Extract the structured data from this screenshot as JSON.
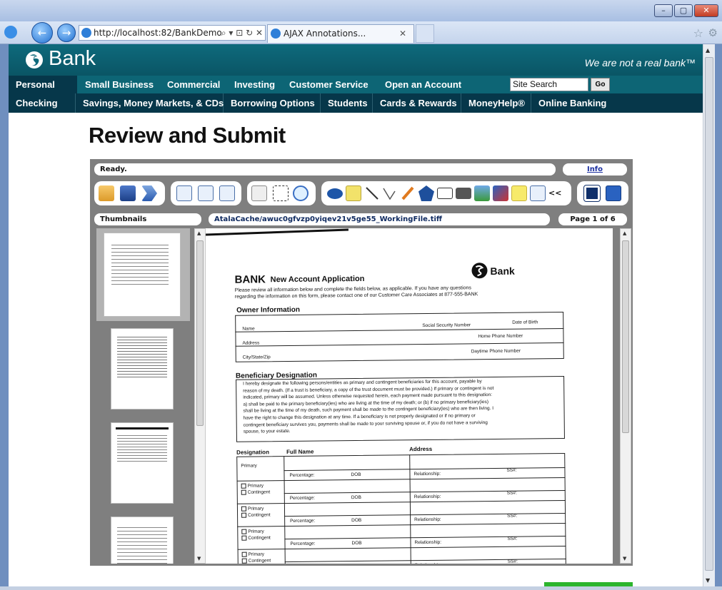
{
  "browser": {
    "window_controls": {
      "minimize": "–",
      "maximize": "▢",
      "close": "✕"
    },
    "address_url": "http://localhost:82/BankDemo",
    "address_tools": "⌕ ▾ ⊡ ↻ ✕",
    "tab_title": "AJAX Annotations...",
    "tab_close": "✕",
    "back_glyph": "←",
    "forward_glyph": "→",
    "favorites_glyph": "☆",
    "tools_glyph": "⚙"
  },
  "site": {
    "brand": "Bank",
    "tagline": "We are not a real bank™",
    "top_nav": [
      "Personal",
      "Small Business",
      "Commercial",
      "Investing",
      "Customer Service",
      "Open an Account"
    ],
    "search_value": "Site Search",
    "go_label": "Go",
    "sub_nav": [
      "Checking",
      "Savings, Money Markets, & CDs",
      "Borrowing Options",
      "Students",
      "Cards & Rewards",
      "MoneyHelp®",
      "Online Banking"
    ],
    "page_title": "Review and Submit"
  },
  "viewer": {
    "status": "Ready.",
    "info_link": "Info",
    "thumbnails_label": "Thumbnails",
    "file_name": "AtalaCache/awuc0gfvzp0yiqev21v5ge55_WorkingFile.tiff",
    "page_indicator": "Page 1 of 6",
    "collapse_glyph": "<<",
    "toolbar_icons": [
      "open-folder-icon",
      "save-icon",
      "forward-icon",
      "zoom-in-icon",
      "zoom-out-icon",
      "fit-page-icon",
      "pan-icon",
      "select-rect-icon",
      "magnifier-icon",
      "ellipse-annotation-icon",
      "text-annotation-icon",
      "line-annotation-icon",
      "lines-annotation-icon",
      "pen-annotation-icon",
      "polygon-annotation-icon",
      "rectangle-annotation-icon",
      "filled-rect-annotation-icon",
      "image-annotation-icon",
      "stamp-annotation-icon",
      "sticky-note-icon",
      "text-box-icon",
      "page-view-icon",
      "page-swap-icon"
    ]
  },
  "document": {
    "brand_heading": "BANK",
    "form_title": "New Account Application",
    "logo_text": "Bank",
    "intro_line1": "Please review all information below and complete the fields below, as applicable. If you have any questions",
    "intro_line2": "regarding the information on this form, please contact one of our Customer Care Associates at 877-555-BANK",
    "owner_heading": "Owner Information",
    "owner_fields": {
      "name": "Name",
      "ssn": "Social Security Number",
      "dob": "Date of Birth",
      "home_phone": "Home Phone Number",
      "address": "Address",
      "city": "City/State/Zip",
      "day_phone": "Daytime Phone Number"
    },
    "beneficiary_heading": "Beneficiary Designation",
    "beneficiary_text": [
      "I hereby designate the following persons/entities as primary and contingent beneficiaries for this account, payable by",
      "reason of my death. (If a trust is beneficiary, a copy of the trust document must be provided.) If primary or contingent is not",
      "indicated, primary will be assumed. Unless otherwise requested herein, each payment made pursuant to this designation:",
      "a) shall be paid to the primary beneficiary(ies) who are living at the time of my death; or (b) if no primary beneficiary(ies)",
      "shall be living at the time of my death, such payment shall be made to the contingent beneficiary(ies) who are then living. I",
      "have the right to change this designation at any time. If a beneficiary is not properly designated or if no primary or",
      "contingent beneficiary survives you, payments shall be made to your surviving spouse or, if you do not have a surviving",
      "spouse, to your estate."
    ],
    "table_headers": {
      "designation": "Designation",
      "full_name": "Full Name",
      "address": "Address"
    },
    "row_labels": {
      "primary": "Primary",
      "contingent": "Contingent",
      "percentage": "Percentage:",
      "dob": "DOB",
      "relationship": "Relationship:",
      "ss": "SS#:"
    }
  }
}
